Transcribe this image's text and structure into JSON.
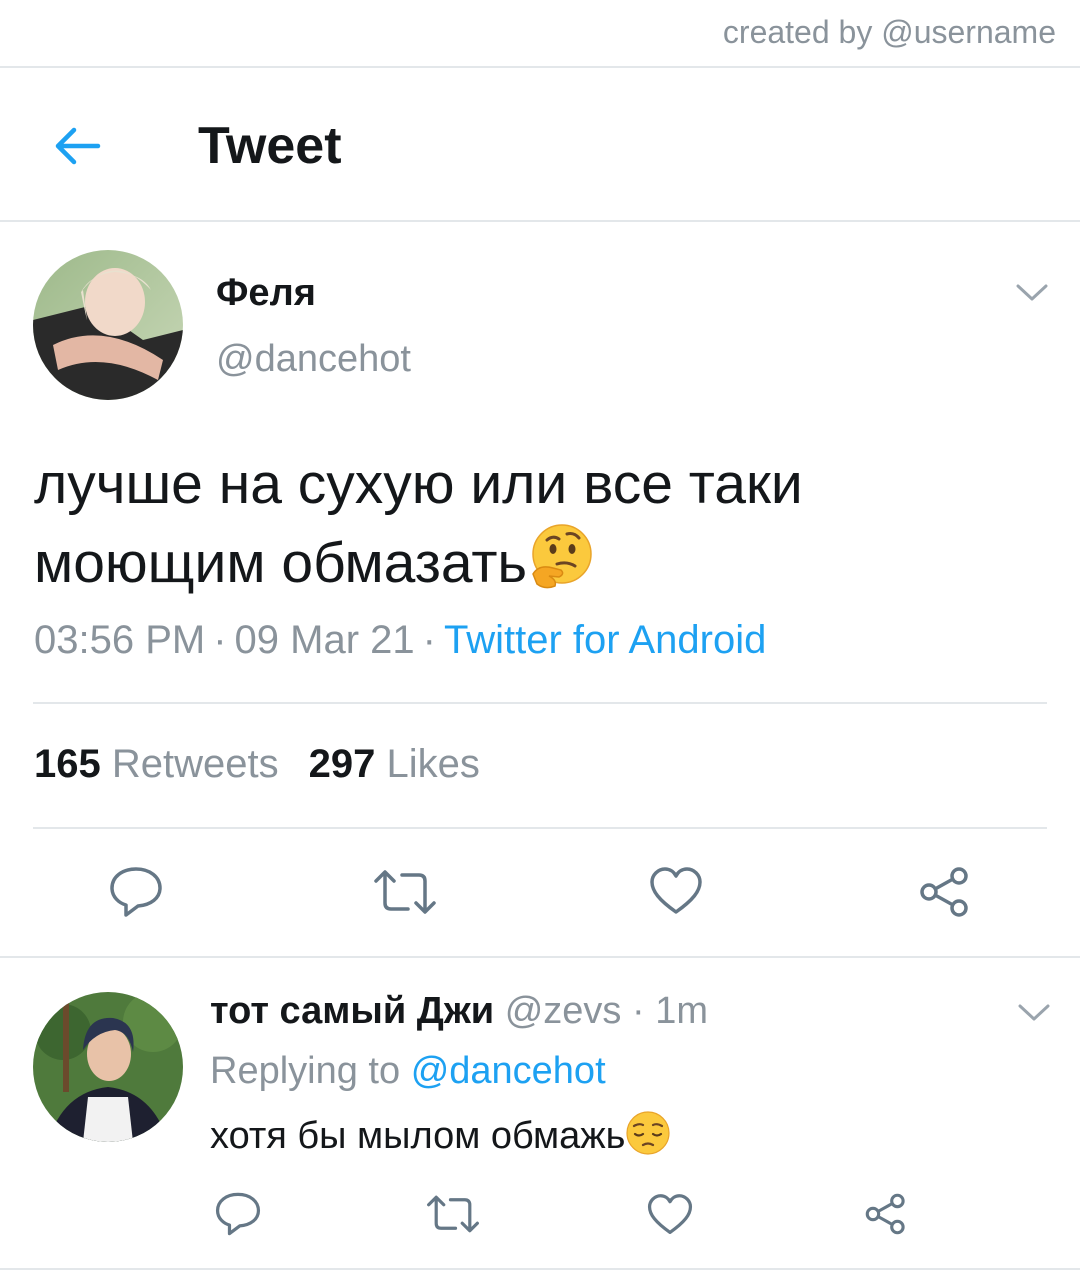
{
  "watermark": "created by @username",
  "header": {
    "title": "Tweet",
    "back_icon": "arrow-left-icon",
    "accent": "#1da1f2"
  },
  "tweet": {
    "author": {
      "name": "Феля",
      "handle": "@dancehot"
    },
    "text_line1": "лучше на сухую или все таки",
    "text_line2": "моющим обмазать",
    "emoji": "thinking-face-emoji",
    "time": "03:56 PM",
    "separator": "·",
    "date": "09 Mar 21",
    "source": "Twitter for Android",
    "retweets_count": "165",
    "retweets_label": "Retweets",
    "likes_count": "297",
    "likes_label": "Likes"
  },
  "reply": {
    "author_name": "тот самый Джи",
    "handle": "@zevs",
    "separator": "·",
    "age": "1m",
    "replying_to_label": "Replying to",
    "replying_to_handle": "@dancehot",
    "text": "хотя бы мылом обмажь",
    "emoji": "pensive-face-emoji"
  },
  "colors": {
    "text": "#14171a",
    "secondary": "#8a939b",
    "link": "#1da1f2",
    "divider": "#e3e7ea"
  }
}
